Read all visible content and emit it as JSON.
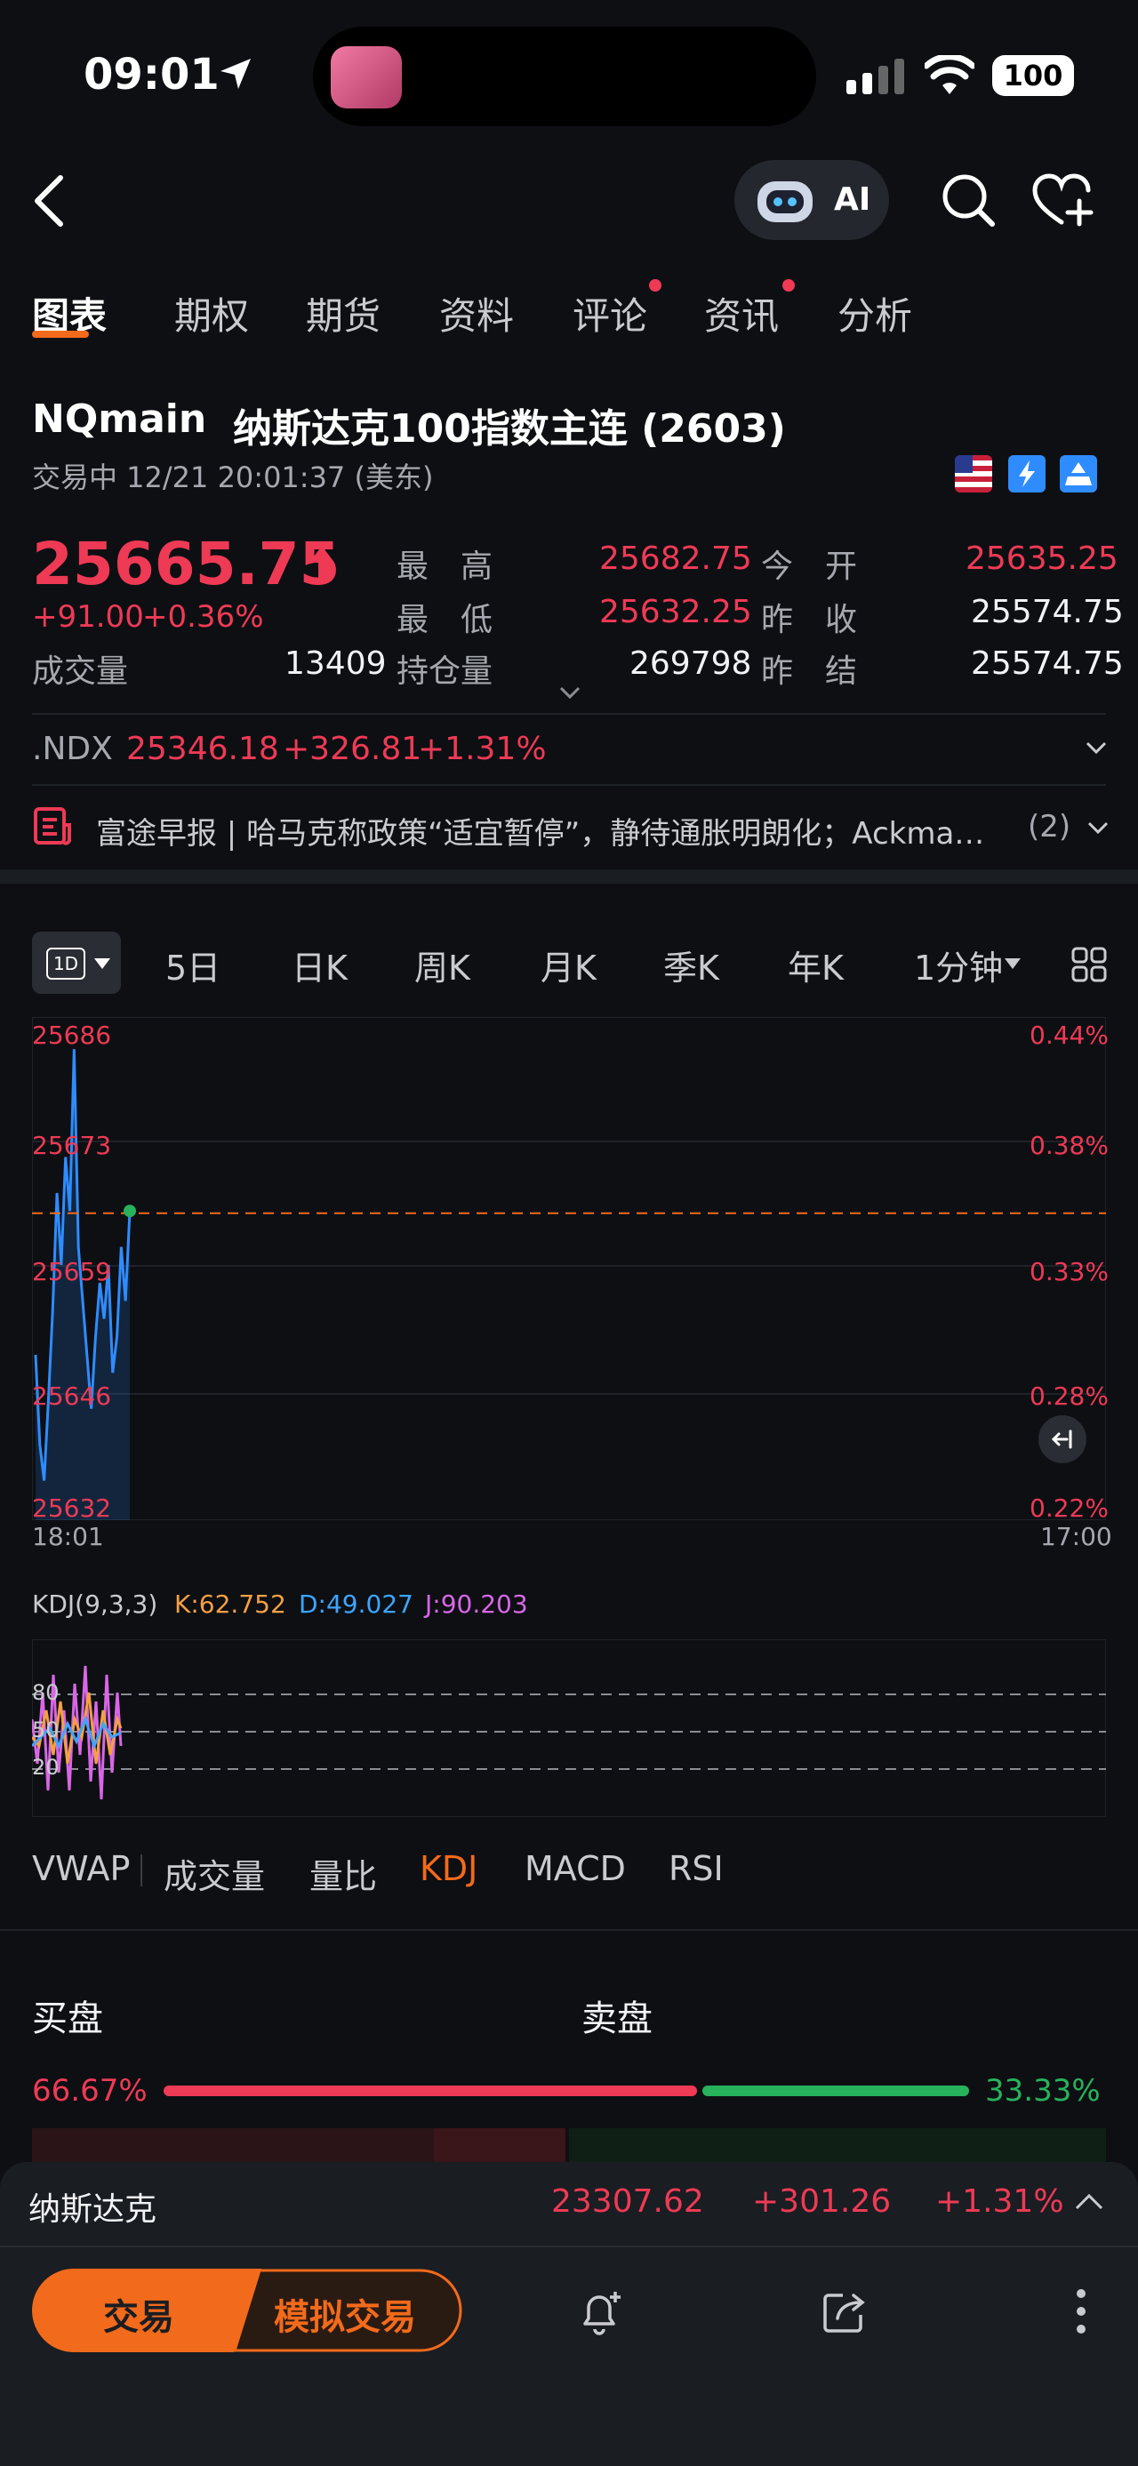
{
  "status_bar": {
    "time": "09:01",
    "battery": "100"
  },
  "header": {
    "ai_label": "AI"
  },
  "tabs": [
    {
      "label": "图表",
      "active": true,
      "dot": false
    },
    {
      "label": "期权",
      "active": false,
      "dot": false
    },
    {
      "label": "期货",
      "active": false,
      "dot": false
    },
    {
      "label": "资料",
      "active": false,
      "dot": false
    },
    {
      "label": "评论",
      "active": false,
      "dot": true
    },
    {
      "label": "资讯",
      "active": false,
      "dot": true
    },
    {
      "label": "分析",
      "active": false,
      "dot": false
    }
  ],
  "quote": {
    "symbol": "NQmain",
    "name": "纳斯达克100指数主连 (2603)",
    "status": "交易中 12/21 20:01:37 (美东)",
    "price": "25665.75",
    "change": "+91.00",
    "change_pct": "+0.36%",
    "volume_label": "成交量",
    "volume": "13409",
    "high_label": "最　高",
    "high": "25682.75",
    "low_label": "最　低",
    "low": "25632.25",
    "oi_label": "持仓量",
    "oi": "269798",
    "open_label": "今　开",
    "open": "25635.25",
    "prev_close_label": "昨　收",
    "prev_close": "25574.75",
    "prev_settle_label": "昨　结",
    "prev_settle": "25574.75"
  },
  "index_row": {
    "symbol": ".NDX",
    "price": "25346.18",
    "change": "+326.81",
    "change_pct": "+1.31%"
  },
  "news": {
    "text": "富途早报 | 哈马克称政策“适宜暂停”，静待通胀明朗化；Ackma…",
    "count": "(2)"
  },
  "periods": {
    "selected": "1D",
    "items": [
      "5日",
      "日K",
      "周K",
      "月K",
      "季K",
      "年K"
    ],
    "minute": "1分钟"
  },
  "chart_data": {
    "type": "line",
    "title": "",
    "y_ticks": [
      "25686",
      "25673",
      "25659",
      "25646",
      "25632"
    ],
    "pct_ticks": [
      "0.44%",
      "0.38%",
      "0.33%",
      "0.28%",
      "0.22%"
    ],
    "x_ticks": [
      "18:01",
      "17:00"
    ],
    "ylim": [
      25632,
      25686
    ],
    "reference_price": 25665.75,
    "series": [
      {
        "values": [
          25650,
          25640,
          25636,
          25645,
          25655,
          25668,
          25660,
          25672,
          25666,
          25684,
          25662,
          25656,
          25650,
          25644,
          25652,
          25658,
          25654,
          25660,
          25648,
          25652,
          25662,
          25656,
          25666
        ]
      }
    ],
    "kdj": {
      "label": "KDJ(9,3,3)",
      "k": "K:62.752",
      "d": "D:49.027",
      "j": "J:90.203",
      "levels": [
        "80",
        "50",
        "20"
      ]
    }
  },
  "indicators": {
    "items": [
      {
        "label": "VWAP",
        "active": false
      },
      {
        "label": "成交量",
        "active": false
      },
      {
        "label": "量比",
        "active": false
      },
      {
        "label": "KDJ",
        "active": true
      },
      {
        "label": "MACD",
        "active": false
      },
      {
        "label": "RSI",
        "active": false
      }
    ]
  },
  "order_book": {
    "buy_label": "买盘",
    "sell_label": "卖盘",
    "buy_pct": "66.67%",
    "sell_pct": "33.33%",
    "buy_ratio": 0.6667
  },
  "ticker": {
    "name": "纳斯达克",
    "price": "23307.62",
    "change": "+301.26",
    "change_pct": "+1.31%"
  },
  "actions": {
    "trade": "交易",
    "paper_trade": "模拟交易"
  },
  "colors": {
    "up": "#ee3a55",
    "down": "#27b25b",
    "accent": "#f26a1b",
    "line": "#2f8cff"
  }
}
